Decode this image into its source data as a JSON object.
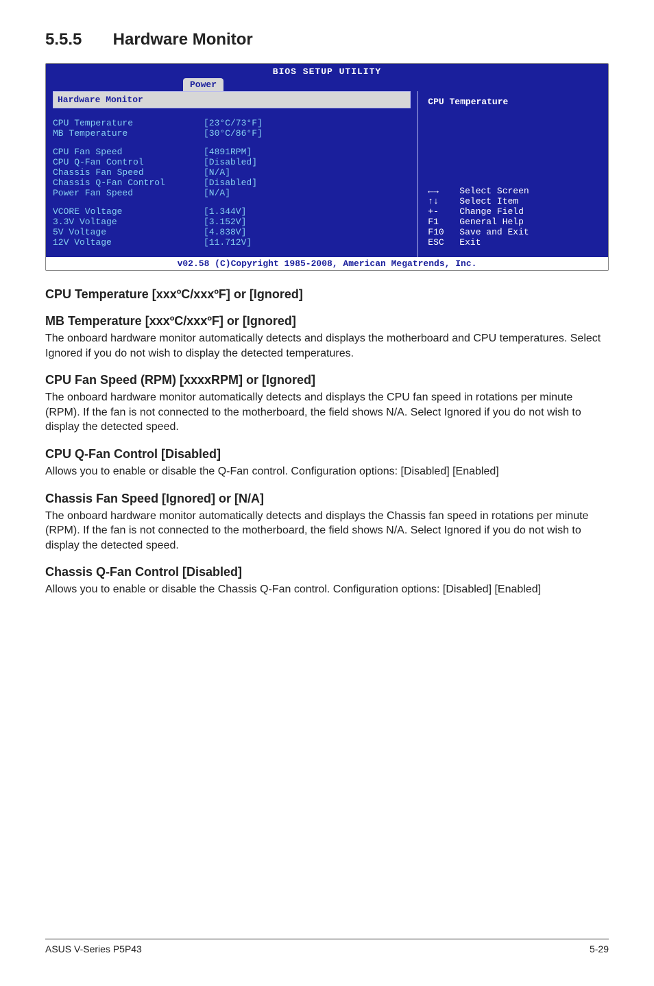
{
  "title": {
    "num": "5.5.5",
    "text": "Hardware Monitor"
  },
  "bios": {
    "heading": "BIOS SETUP UTILITY",
    "tab": "Power",
    "panel_title": "Hardware Monitor",
    "groups": [
      [
        {
          "label": "CPU Temperature",
          "value": "[23°C/73°F]"
        },
        {
          "label": "MB Temperature",
          "value": "[30°C/86°F]"
        }
      ],
      [
        {
          "label": "CPU Fan Speed",
          "value": "[4891RPM]"
        },
        {
          "label": "CPU Q-Fan Control",
          "value": "[Disabled]"
        },
        {
          "label": "Chassis Fan Speed",
          "value": "[N/A]"
        },
        {
          "label": "Chassis Q-Fan Control",
          "value": "[Disabled]"
        },
        {
          "label": "Power Fan Speed",
          "value": "[N/A]"
        }
      ],
      [
        {
          "label": "VCORE Voltage",
          "value": "[1.344V]"
        },
        {
          "label": "3.3V Voltage",
          "value": "[3.152V]"
        },
        {
          "label": "5V Voltage",
          "value": "[4.838V]"
        },
        {
          "label": "12V Voltage",
          "value": "[11.712V]"
        }
      ]
    ],
    "help_title": "CPU Temperature",
    "nav": [
      {
        "key": "lr",
        "text": "Select Screen"
      },
      {
        "key": "ud",
        "text": "Select Item"
      },
      {
        "key": "+-",
        "text": "Change Field"
      },
      {
        "key": "F1",
        "text": "General Help"
      },
      {
        "key": "F10",
        "text": "Save and Exit"
      },
      {
        "key": "ESC",
        "text": "Exit"
      }
    ],
    "footer": "v02.58 (C)Copyright 1985-2008, American Megatrends, Inc."
  },
  "sections": [
    {
      "h": "CPU Temperature [xxxºC/xxxºF] or [Ignored]",
      "p": ""
    },
    {
      "h": "MB Temperature [xxxºC/xxxºF] or [Ignored]",
      "p": "The onboard hardware monitor automatically detects and displays the motherboard and CPU temperatures. Select Ignored if you do not wish to display the detected temperatures."
    },
    {
      "h": "CPU Fan Speed (RPM) [xxxxRPM] or [Ignored]",
      "p": "The onboard hardware monitor automatically detects and displays the CPU fan speed in rotations per minute (RPM). If the fan is not connected to the motherboard, the field shows N/A. Select Ignored if you do not wish to display the detected speed."
    },
    {
      "h": "CPU Q-Fan Control [Disabled]",
      "p": "Allows you to enable or disable the Q-Fan control. Configuration options: [Disabled] [Enabled]"
    },
    {
      "h": "Chassis Fan Speed [Ignored] or [N/A]",
      "p": "The onboard hardware monitor automatically detects and displays the Chassis fan speed in rotations per minute (RPM). If the fan is not connected to the motherboard, the field shows N/A. Select Ignored if you do not wish to display the detected speed."
    },
    {
      "h": "Chassis Q-Fan Control [Disabled]",
      "p": "Allows you to enable or disable the Chassis Q-Fan control. Configuration options: [Disabled] [Enabled]"
    }
  ],
  "footer": {
    "left": "ASUS V-Series P5P43",
    "right": "5-29"
  }
}
